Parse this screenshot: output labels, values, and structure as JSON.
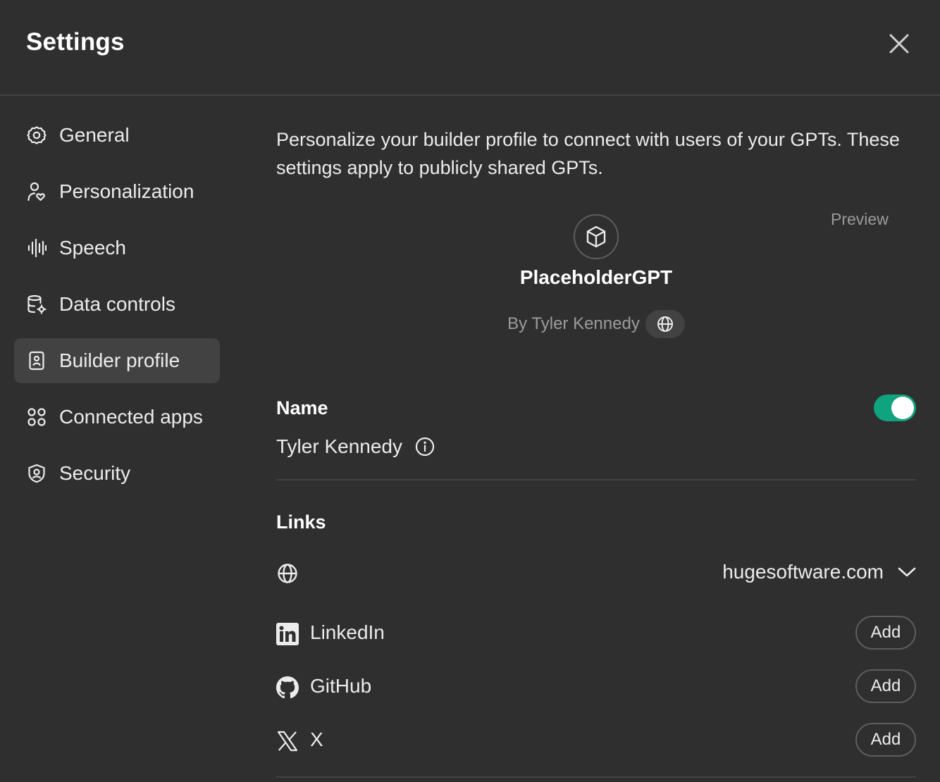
{
  "header": {
    "title": "Settings"
  },
  "sidebar": {
    "items": [
      {
        "label": "General",
        "icon": "gear-icon"
      },
      {
        "label": "Personalization",
        "icon": "person-heart-icon"
      },
      {
        "label": "Speech",
        "icon": "waveform-icon"
      },
      {
        "label": "Data controls",
        "icon": "database-gear-icon"
      },
      {
        "label": "Builder profile",
        "icon": "id-badge-icon",
        "active": true
      },
      {
        "label": "Connected apps",
        "icon": "apps-grid-icon"
      },
      {
        "label": "Security",
        "icon": "shield-user-icon"
      }
    ]
  },
  "main": {
    "description": "Personalize your builder profile to connect with users of your GPTs. These settings apply to publicly shared GPTs.",
    "preview": {
      "label": "Preview",
      "gpt_name": "PlaceholderGPT",
      "byline": "By Tyler Kennedy"
    },
    "name_section": {
      "title": "Name",
      "value": "Tyler Kennedy",
      "toggle_on": true
    },
    "links_section": {
      "title": "Links",
      "website": {
        "value": "hugesoftware.com"
      },
      "items": [
        {
          "label": "LinkedIn",
          "button": "Add"
        },
        {
          "label": "GitHub",
          "button": "Add"
        },
        {
          "label": "X",
          "button": "Add"
        }
      ]
    }
  },
  "colors": {
    "background": "#2f2f2f",
    "active_item": "#424242",
    "divider": "#424242",
    "toggle_on": "#10a37f",
    "muted_text": "#9b9b9b"
  }
}
